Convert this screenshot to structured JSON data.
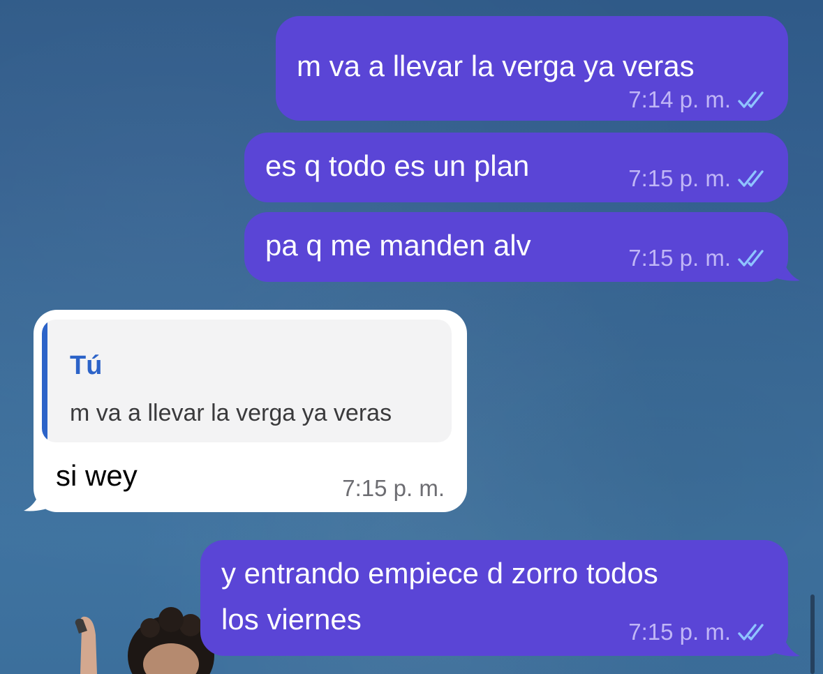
{
  "chat": {
    "messages": [
      {
        "direction": "outgoing",
        "text": "m va a llevar la verga ya veras",
        "time": "7:14 p. m.",
        "status": "read"
      },
      {
        "direction": "outgoing",
        "text": "es q todo es un plan",
        "time": "7:15 p. m.",
        "status": "read"
      },
      {
        "direction": "outgoing",
        "text": "pa q me manden alv",
        "time": "7:15 p. m.",
        "status": "read"
      },
      {
        "direction": "incoming",
        "reply_to": {
          "author": "Tú",
          "text": "m va a llevar la verga ya veras"
        },
        "text": "si wey",
        "time": "7:15 p. m."
      },
      {
        "direction": "outgoing",
        "text_line1": "y entrando empiece d zorro todos",
        "text_line2": "los viernes",
        "time": "7:15 p. m.",
        "status": "read"
      }
    ]
  },
  "colors": {
    "outgoing_bubble": "#5a45d6",
    "incoming_bubble": "#ffffff",
    "reply_accent": "#2c63c8",
    "read_check": "#8fc4ff",
    "background": "#36628f"
  },
  "icons": {
    "read_status": "double-check-icon"
  }
}
